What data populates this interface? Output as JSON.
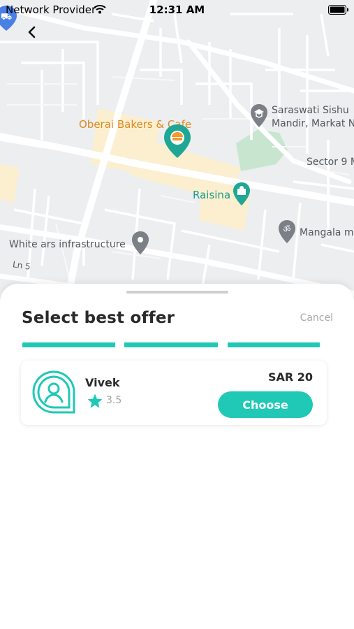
{
  "status_bar": {
    "carrier": "Network Provider",
    "time": "12:31 AM",
    "wifi_icon": "wifi-icon",
    "battery_icon": "battery-icon"
  },
  "nav": {
    "back_icon": "chevron-left-icon"
  },
  "map": {
    "labels": {
      "bakery": "Oberai Bakers & Cafe",
      "school_line1": "Saraswati Sishu",
      "school_line2": "Mandir, Markat N",
      "sector": "Sector 9 M",
      "raisina": "Raisina",
      "mangala": "Mangala m",
      "infra": "White ars infrastructure",
      "lane": "Ln 5"
    },
    "colors": {
      "background": "#eceef0",
      "road": "#ffffff",
      "highlight": "#fbefcf",
      "park": "#c8e6cf",
      "pin_teal": "#1fa795",
      "pin_grey": "#7b8087"
    }
  },
  "sheet": {
    "title": "Select best offer",
    "cancel_label": "Cancel",
    "progress_segments": 3
  },
  "offer": {
    "driver_name": "Vivek",
    "rating": "3.5",
    "price": "SAR 20",
    "choose_label": "Choose"
  },
  "colors": {
    "accent": "#1fc9b6",
    "text_primary": "#2a2a2a",
    "text_muted": "#a9a9a9"
  }
}
